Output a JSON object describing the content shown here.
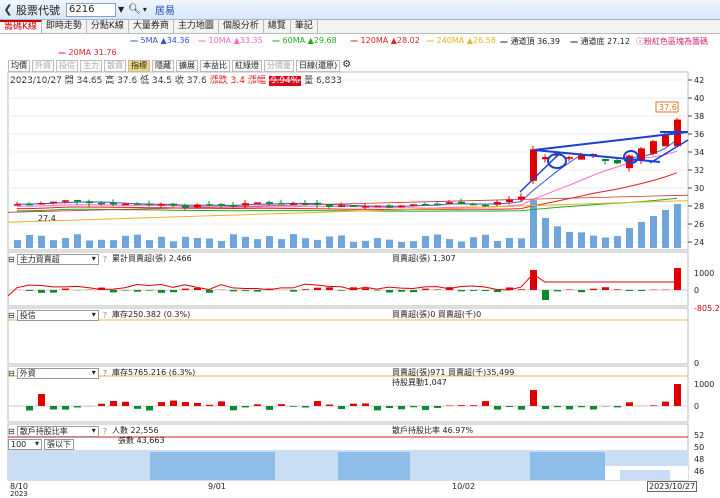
{
  "header": {
    "title": "股票代號",
    "code": "6216",
    "name": "居易"
  },
  "tabs": [
    "籌碼K線",
    "即時走勢",
    "分點K線",
    "大量券商",
    "主力地圖",
    "個股分析",
    "總覽",
    "筆記"
  ],
  "ma_legend": [
    {
      "label": "5MA ▲34.36",
      "color": "#3355cc"
    },
    {
      "label": "10MA ▲33.35",
      "color": "#ff66cc"
    },
    {
      "label": "60MA ▲29.68",
      "color": "#22aa22"
    },
    {
      "label": "120MA ▲28.02",
      "color": "#dd2222"
    },
    {
      "label": "240MA ▲26.58",
      "color": "#e6b422"
    },
    {
      "label": "通道頂 36.39",
      "color": "#222222"
    },
    {
      "label": "通道底 27.12",
      "color": "#222222"
    },
    {
      "label": "20MA 31.76",
      "color": "#dd2222"
    }
  ],
  "note_link": "ⓘ粉紅色區塊為籌碼",
  "toolbar": [
    "均價",
    "外資",
    "投信",
    "主力",
    "散資",
    "指標",
    "隱藏",
    "擴展",
    "本益比",
    "紅綠燈",
    "分價量",
    "日線(還原)"
  ],
  "quote": {
    "date": "2023/10/27",
    "open_label": "開",
    "open": "34.65",
    "high_label": "高",
    "high": "37.6",
    "low_label": "低",
    "low": "34.5",
    "close_label": "收",
    "close": "37.6",
    "chg_label": "漲跌",
    "chg": "3.4",
    "pct_label": "漲幅",
    "pct": "9.94%",
    "vol_label": "量",
    "vol": "6,833"
  },
  "price_axis": [
    "42",
    "40",
    "38",
    "36",
    "34",
    "32",
    "30",
    "28",
    "26",
    "24"
  ],
  "price_marker_high": "37.6",
  "price_marker_low": "27.4",
  "panels": {
    "main_force": {
      "select": "主力買賣超",
      "text1": "累計買賣超(張) 2,466",
      "text2": "買賣超(張) 1,307",
      "axis": [
        "1000",
        "0"
      ]
    },
    "trust": {
      "select": "投信",
      "text1": "庫存250.382 (0.3%)",
      "text2": "買賣超(張)0 買賣超(千)0",
      "axis": [
        "-805.2",
        "0"
      ]
    },
    "foreign": {
      "select": "外資",
      "text1": "庫存5765.216 (6.3%)",
      "text2": "買賣超(張)971 買賣超(千)35,499",
      "text3": "持股異動1,047",
      "axis": [
        "1000",
        "0"
      ]
    },
    "holders": {
      "select": "散戶持股比率",
      "filter": "100",
      "filter_suffix": "張以下",
      "text1": "人數 22,556",
      "text2": "張數 43,663",
      "text3": "散戶持股比率 46.97%",
      "axis": [
        "52",
        "50",
        "48",
        "46"
      ]
    }
  },
  "dates": [
    "8/10",
    "2023",
    "9/01",
    "10/02",
    "2023/10/27"
  ]
}
